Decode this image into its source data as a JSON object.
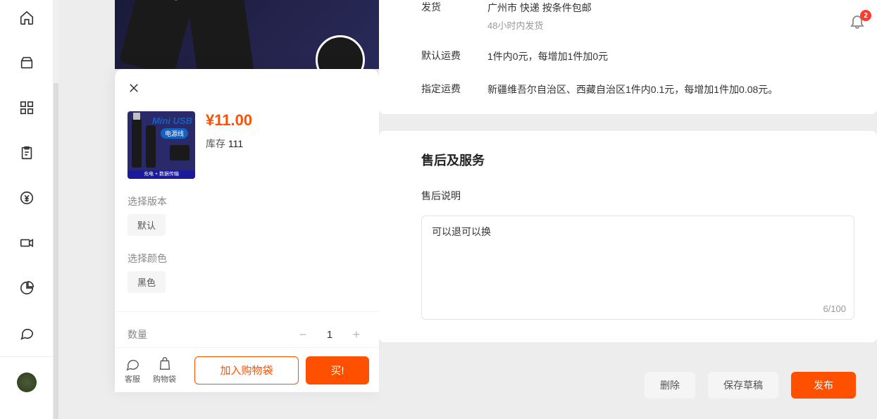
{
  "notificationBadge": "2",
  "popup": {
    "thumbTitle": "Mini USB",
    "thumbBadge": "电源线",
    "thumbBottom": "充电 + 数据传输",
    "price": "¥11.00",
    "stockLabel": "库存",
    "stockValue": "111",
    "versionLabel": "选择版本",
    "versionOption": "默认",
    "colorLabel": "选择颜色",
    "colorOption": "黑色",
    "qtyLabel": "数量",
    "qtyValue": "1",
    "serviceLabel": "客服",
    "bagLabel": "购物袋",
    "addToCart": "加入购物袋",
    "buy": "买!"
  },
  "shipping": {
    "row1Label": "发货",
    "row1Value": "广州市 快递 按条件包邮",
    "row1Sub": "48小时内发货",
    "row2Label": "默认运费",
    "row2Value": "1件内0元，每增加1件加0元",
    "row3Label": "指定运费",
    "row3Value": "新疆维吾尔自治区、西藏自治区1件内0.1元，每增加1件加0.08元。"
  },
  "service": {
    "title": "售后及服务",
    "label": "售后说明",
    "textareaValue": "可以退可以换",
    "charCount": "6/100"
  },
  "actions": {
    "delete": "删除",
    "saveDraft": "保存草稿",
    "publish": "发布"
  }
}
